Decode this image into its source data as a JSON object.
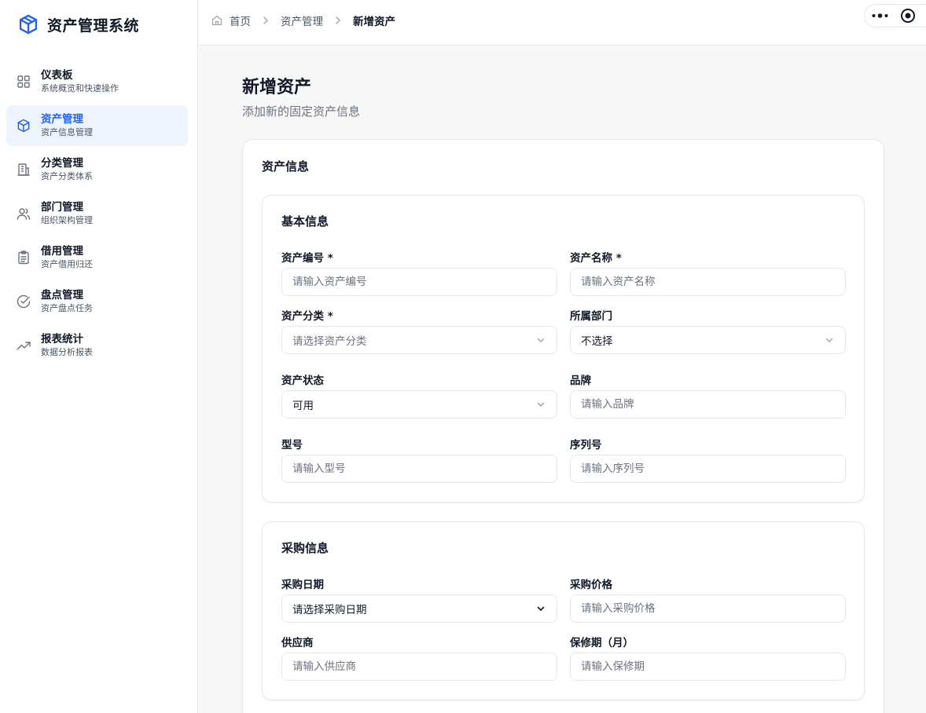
{
  "app": {
    "title": "资产管理系统",
    "logo_icon": "cube-icon",
    "accent": "#2563eb"
  },
  "sidebar": {
    "items": [
      {
        "label": "仪表板",
        "sub": "系统概览和快速操作",
        "icon": "grid-icon",
        "active": false
      },
      {
        "label": "资产管理",
        "sub": "资产信息管理",
        "icon": "cube-icon",
        "active": true
      },
      {
        "label": "分类管理",
        "sub": "资产分类体系",
        "icon": "building-icon",
        "active": false
      },
      {
        "label": "部门管理",
        "sub": "组织架构管理",
        "icon": "users-icon",
        "active": false
      },
      {
        "label": "借用管理",
        "sub": "资产借用归还",
        "icon": "clipboard-icon",
        "active": false
      },
      {
        "label": "盘点管理",
        "sub": "资产盘点任务",
        "icon": "check-circle-icon",
        "active": false
      },
      {
        "label": "报表统计",
        "sub": "数据分析报表",
        "icon": "trend-up-icon",
        "active": false
      }
    ]
  },
  "header": {
    "breadcrumb": {
      "home": "首页",
      "parent": "资产管理",
      "current": "新增资产"
    }
  },
  "page": {
    "title": "新增资产",
    "subtitle": "添加新的固定资产信息"
  },
  "card": {
    "title": "资产信息"
  },
  "basic": {
    "title": "基本信息",
    "asset_code": {
      "label": "资产编号 *",
      "placeholder": "请输入资产编号"
    },
    "asset_name": {
      "label": "资产名称 *",
      "placeholder": "请输入资产名称"
    },
    "category": {
      "label": "资产分类 *",
      "placeholder": "请选择资产分类"
    },
    "department": {
      "label": "所属部门",
      "value": "不选择"
    },
    "status": {
      "label": "资产状态",
      "value": "可用"
    },
    "brand": {
      "label": "品牌",
      "placeholder": "请输入品牌"
    },
    "model": {
      "label": "型号",
      "placeholder": "请输入型号"
    },
    "serial": {
      "label": "序列号",
      "placeholder": "请输入序列号"
    }
  },
  "purchase": {
    "title": "采购信息",
    "date": {
      "label": "采购日期",
      "value": "请选择采购日期"
    },
    "price": {
      "label": "采购价格",
      "placeholder": "请输入采购价格"
    },
    "supplier": {
      "label": "供应商",
      "placeholder": "请输入供应商"
    },
    "warranty": {
      "label": "保修期（月）",
      "placeholder": "请输入保修期"
    }
  }
}
